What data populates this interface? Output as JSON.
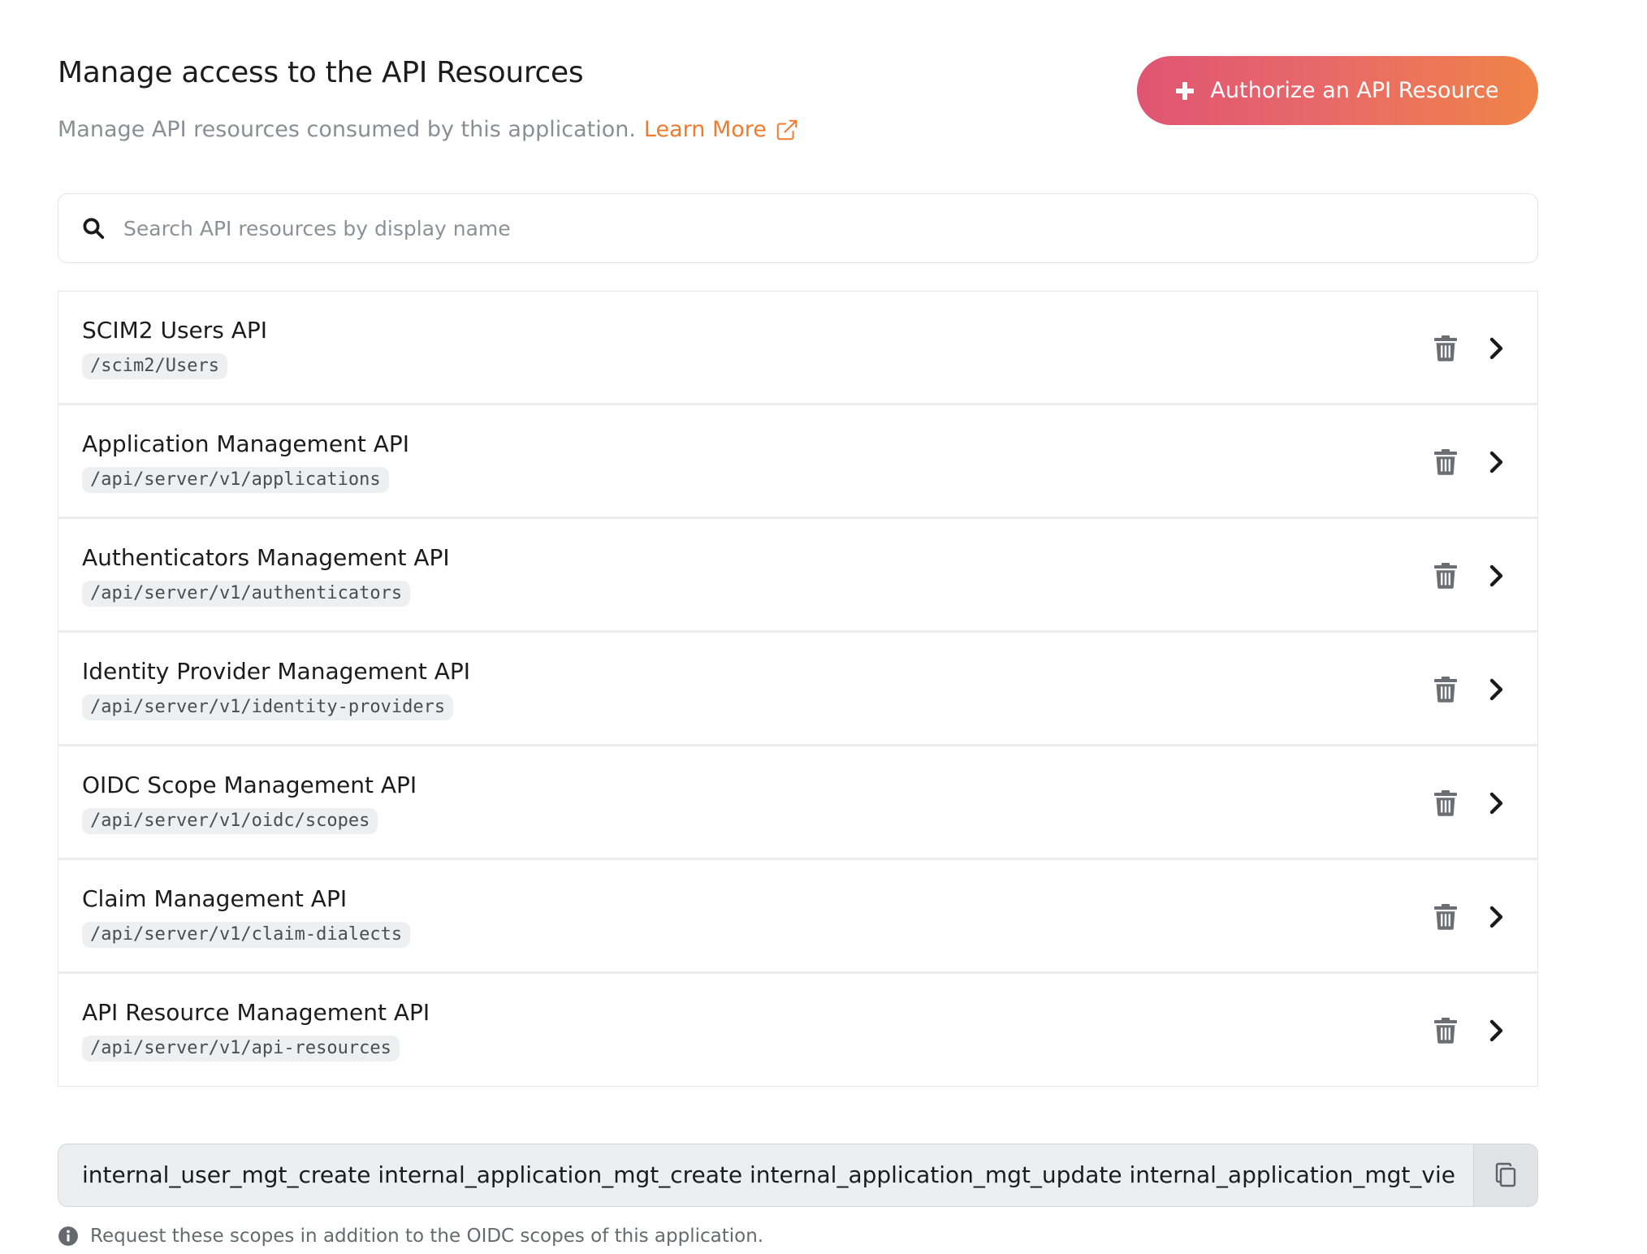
{
  "header": {
    "title": "Manage access to the API Resources",
    "subtitle": "Manage API resources consumed by this application.",
    "learn_more": "Learn More",
    "authorize_button": "Authorize an API Resource"
  },
  "search": {
    "placeholder": "Search API resources by display name",
    "value": ""
  },
  "resources": [
    {
      "name": "SCIM2 Users API",
      "path": "/scim2/Users"
    },
    {
      "name": "Application Management API",
      "path": "/api/server/v1/applications"
    },
    {
      "name": "Authenticators Management API",
      "path": "/api/server/v1/authenticators"
    },
    {
      "name": "Identity Provider Management API",
      "path": "/api/server/v1/identity-providers"
    },
    {
      "name": "OIDC Scope Management API",
      "path": "/api/server/v1/oidc/scopes"
    },
    {
      "name": "Claim Management API",
      "path": "/api/server/v1/claim-dialects"
    },
    {
      "name": "API Resource Management API",
      "path": "/api/server/v1/api-resources"
    }
  ],
  "scopes": {
    "value": "internal_user_mgt_create internal_application_mgt_create internal_application_mgt_update internal_application_mgt_vie",
    "hint": "Request these scopes in addition to the OIDC scopes of this application."
  },
  "icons": {
    "search": "search-icon",
    "external_link": "external-link-icon",
    "plus": "plus-icon",
    "delete": "trash-icon",
    "chevron": "chevron-right-icon",
    "copy": "copy-icon",
    "info": "info-icon"
  },
  "colors": {
    "accent_orange": "#f07b2d",
    "button_gradient_start": "#df5572",
    "button_gradient_end": "#ef8447",
    "muted_text": "#8b8f94"
  }
}
